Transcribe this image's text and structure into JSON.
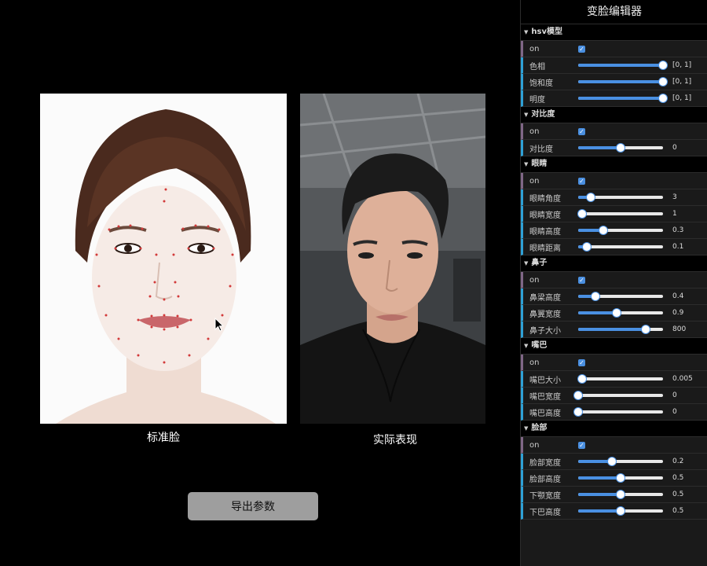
{
  "panel": {
    "title": "变脸编辑器",
    "folders": [
      {
        "title": "hsv模型",
        "rows": [
          {
            "type": "check",
            "label": "on",
            "checked": true
          },
          {
            "type": "slider",
            "label": "色相",
            "fill": 1.0,
            "value": "[0, 1]"
          },
          {
            "type": "slider",
            "label": "饱和度",
            "fill": 1.0,
            "value": "[0, 1]"
          },
          {
            "type": "slider",
            "label": "明度",
            "fill": 1.0,
            "value": "[0, 1]"
          }
        ]
      },
      {
        "title": "对比度",
        "rows": [
          {
            "type": "check",
            "label": "on",
            "checked": true
          },
          {
            "type": "slider",
            "label": "对比度",
            "fill": 0.5,
            "value": "0"
          }
        ]
      },
      {
        "title": "眼睛",
        "rows": [
          {
            "type": "check",
            "label": "on",
            "checked": true
          },
          {
            "type": "slider",
            "label": "眼睛角度",
            "fill": 0.15,
            "value": "3"
          },
          {
            "type": "slider",
            "label": "眼睛宽度",
            "fill": 0.05,
            "value": "1"
          },
          {
            "type": "slider",
            "label": "眼睛高度",
            "fill": 0.3,
            "value": "0.3"
          },
          {
            "type": "slider",
            "label": "眼睛距离",
            "fill": 0.1,
            "value": "0.1"
          }
        ]
      },
      {
        "title": "鼻子",
        "rows": [
          {
            "type": "check",
            "label": "on",
            "checked": true
          },
          {
            "type": "slider",
            "label": "鼻梁高度",
            "fill": 0.2,
            "value": "0.4"
          },
          {
            "type": "slider",
            "label": "鼻翼宽度",
            "fill": 0.45,
            "value": "0.9"
          },
          {
            "type": "slider",
            "label": "鼻子大小",
            "fill": 0.8,
            "value": "800"
          }
        ]
      },
      {
        "title": "嘴巴",
        "rows": [
          {
            "type": "check",
            "label": "on",
            "checked": true
          },
          {
            "type": "slider",
            "label": "嘴巴大小",
            "fill": 0.05,
            "value": "0.005"
          },
          {
            "type": "slider",
            "label": "嘴巴宽度",
            "fill": 0.0,
            "value": "0"
          },
          {
            "type": "slider",
            "label": "嘴巴高度",
            "fill": 0.0,
            "value": "0"
          }
        ]
      },
      {
        "title": "脸部",
        "rows": [
          {
            "type": "check",
            "label": "on",
            "checked": true
          },
          {
            "type": "slider",
            "label": "脸部宽度",
            "fill": 0.4,
            "value": "0.2"
          },
          {
            "type": "slider",
            "label": "脸部高度",
            "fill": 0.5,
            "value": "0.5"
          },
          {
            "type": "slider",
            "label": "下颚宽度",
            "fill": 0.5,
            "value": "0.5"
          },
          {
            "type": "slider",
            "label": "下巴高度",
            "fill": 0.5,
            "value": "0.5"
          }
        ]
      }
    ]
  },
  "main": {
    "standard_caption": "标准脸",
    "actual_caption": "实际表现",
    "export_label": "导出参数"
  },
  "colors": {
    "accent": "#4a90e2",
    "bool_bar": "#806787",
    "num_bar": "#2fa1d6"
  }
}
